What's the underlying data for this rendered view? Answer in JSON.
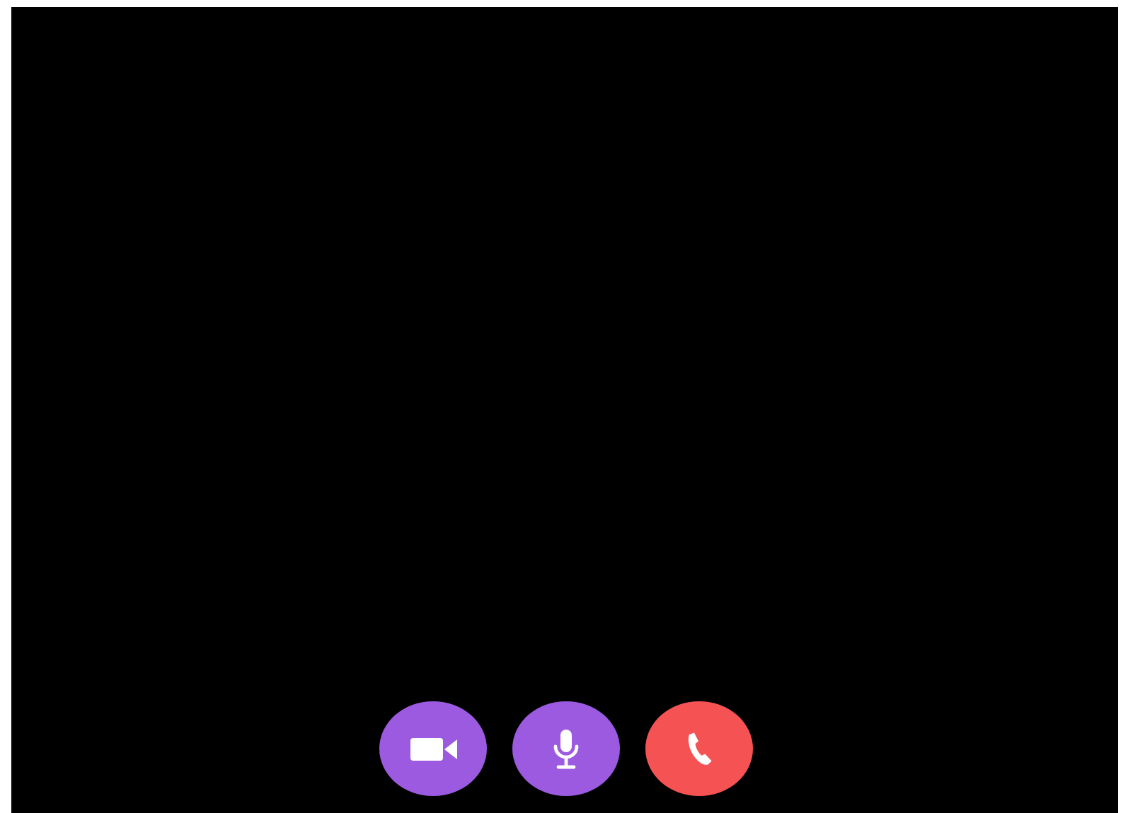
{
  "call_controls": [
    {
      "kind": "camera",
      "color": "#9c5ae0"
    },
    {
      "kind": "microphone",
      "color": "#9c5ae0"
    },
    {
      "kind": "hangup",
      "color": "#f55353"
    }
  ]
}
